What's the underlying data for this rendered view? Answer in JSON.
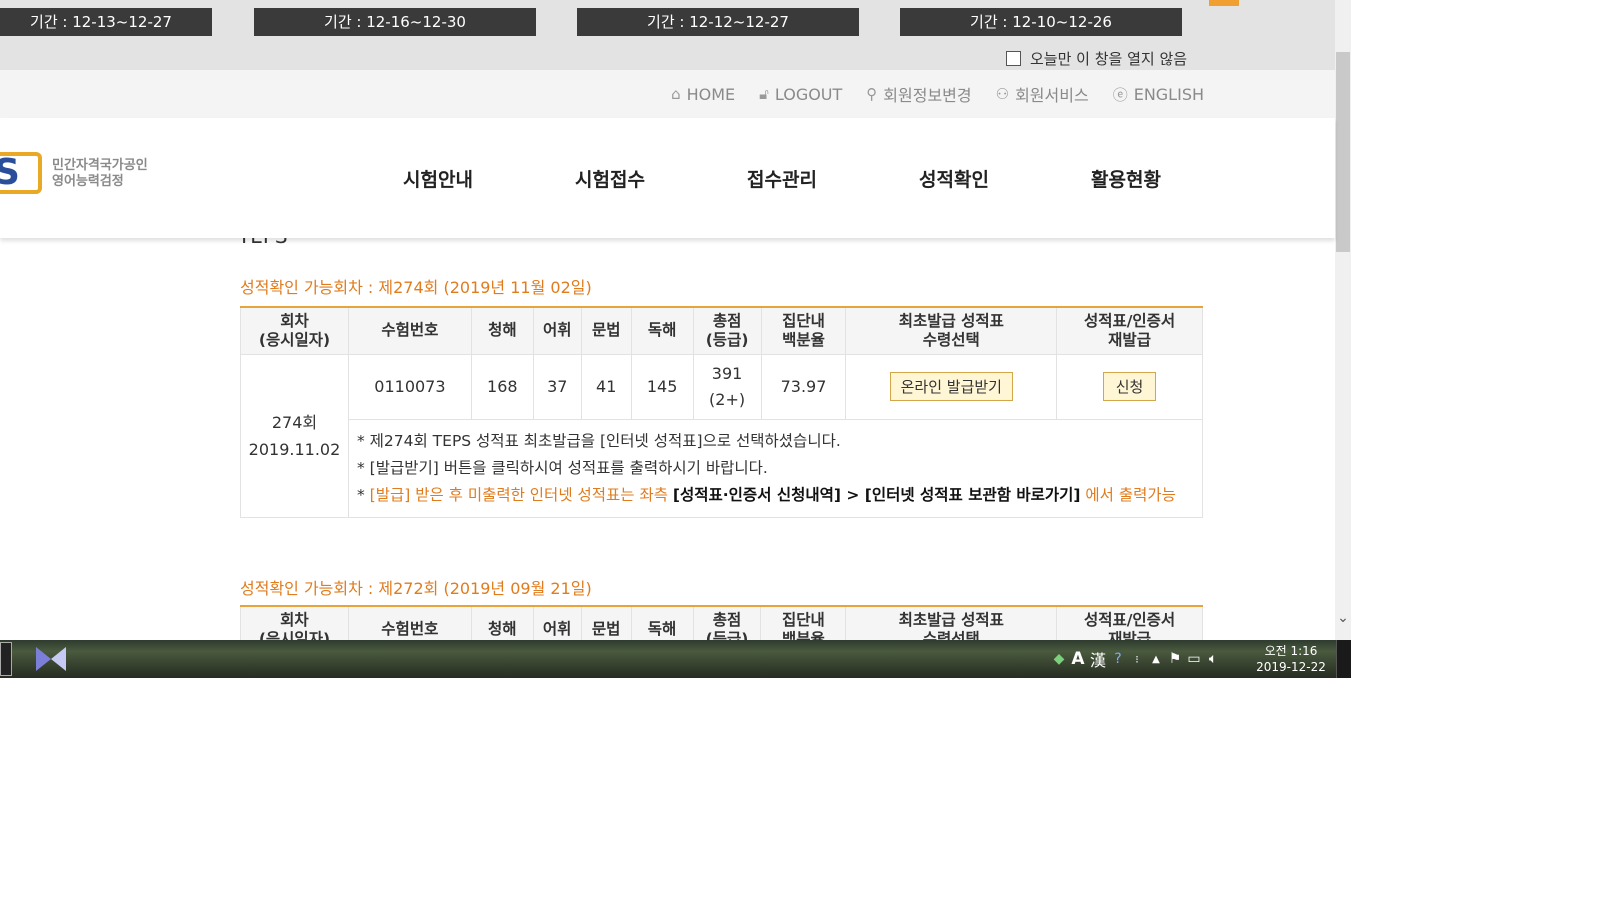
{
  "popup": {
    "period_tabs": [
      "기간 : 12-13~12-27",
      "기간 : 12-16~12-30",
      "기간 : 12-12~12-27",
      "기간 : 12-10~12-26"
    ],
    "dont_open_today": "오늘만 이 창을 열지 않음"
  },
  "util_nav": {
    "home": "HOME",
    "logout": "LOGOUT",
    "member_edit": "회원정보변경",
    "member_service": "회원서비스",
    "english": "ENGLISH"
  },
  "logo": {
    "letter": "S",
    "line1": "민간자격국가공인",
    "line2": "영어능력검정"
  },
  "gnb": [
    "시험안내",
    "시험접수",
    "접수관리",
    "성적확인",
    "활용현황"
  ],
  "section_title": "TEPS",
  "table_headers": {
    "round": [
      "회차",
      "(응시일자)"
    ],
    "exam_no": "수험번호",
    "listening": "청해",
    "vocab": "어휘",
    "grammar": "문법",
    "reading": "독해",
    "total": [
      "총점",
      "(등급)"
    ],
    "percentile": [
      "집단내",
      "백분율"
    ],
    "first_issue": [
      "최초발급 성적표",
      "수령선택"
    ],
    "reissue": [
      "성적표/인증서",
      "재발급"
    ]
  },
  "rounds": [
    {
      "caption": "성적확인 가능회차 : 제274회 (2019년 11월 02일)",
      "round": "274회",
      "date": "2019.11.02",
      "exam_no": "0110073",
      "listening": "168",
      "vocab": "37",
      "grammar": "41",
      "reading": "145",
      "total": "391",
      "grade": "(2+)",
      "percentile": "73.97",
      "online_btn": "온라인 발급받기",
      "apply_btn": "신청",
      "notes": {
        "n1": "* 제274회 TEPS 성적표 최초발급을 [인터넷 성적표]으로 선택하셨습니다.",
        "n2": "* [발급받기] 버튼을 클릭하시여 성적표를 출력하시기 바랍니다.",
        "n3_star": "* ",
        "n3_orange1": "[발급] 받은 후 미출력한 인터넷 성적표는 좌측 ",
        "n3_bold": "[성적표·인증서 신청내역] > [인터넷 성적표 보관함 바로가기]",
        "n3_orange2": " 에서 출력가능"
      }
    },
    {
      "caption": "성적확인 가능회차 : 제272회 (2019년 09월 21일)"
    }
  ],
  "taskbar": {
    "clock_line1": "오전 1:16",
    "clock_line2": "2019-12-22",
    "ime_a": "A",
    "ime_han": "漢"
  }
}
